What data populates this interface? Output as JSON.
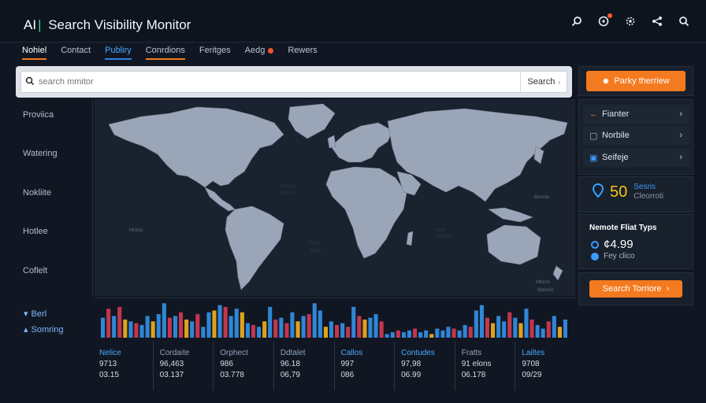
{
  "app": {
    "title_prefix": "AI",
    "title": "Search Visibility Monitor"
  },
  "top_icons": [
    "search-icon",
    "alert-icon",
    "settings-icon",
    "share-icon",
    "search-icon"
  ],
  "tabs": [
    {
      "label": "Nohiel"
    },
    {
      "label": "Contact"
    },
    {
      "label": "Publiry"
    },
    {
      "label": "Conrdions"
    },
    {
      "label": "Feritges"
    },
    {
      "label": "Aedg"
    },
    {
      "label": "Rewers"
    }
  ],
  "search": {
    "placeholder": "search mmitor",
    "button_label": "Search"
  },
  "leftnav": {
    "items": [
      "Proviica",
      "Watering",
      "Nokliite",
      "Hotlee",
      "Coflelt"
    ]
  },
  "map_labels": [
    "Desnia",
    "Cadsos",
    "Mroiss",
    "Nenit",
    "Reep",
    "Nolat",
    "Edmore",
    "Bosnia",
    "Mhens",
    "Moinsin"
  ],
  "legend": {
    "item1": "Berl",
    "item2": "Somring"
  },
  "table": {
    "columns": [
      {
        "header": "Nelice",
        "v1": "9713",
        "v2": "03.15"
      },
      {
        "header": "Cordaite",
        "v1": "96,463",
        "v2": "03.137"
      },
      {
        "header": "Orphect",
        "v1": "986",
        "v2": "03.778"
      },
      {
        "header": "Ddtalet",
        "v1": "96.18",
        "v2": "06,79"
      },
      {
        "header": "Callos",
        "v1": "997",
        "v2": "086"
      },
      {
        "header": "Contudes",
        "v1": "97,98",
        "v2": "06.99"
      },
      {
        "header": "Fratts",
        "v1": "91 elons",
        "v2": "06.178"
      },
      {
        "header": "Lailtes",
        "v1": "9708",
        "v2": "09/29"
      }
    ]
  },
  "right": {
    "primary_button": "Parky therriew",
    "items": [
      "Fianter",
      "Norbile",
      "Seifeje"
    ],
    "stat": {
      "value": "50",
      "label_a": "Sesris",
      "label_b": "Cleorroti"
    },
    "section_title": "Nemote Fliat Typs",
    "price": "¢4.99",
    "price_sub": "Fey clico",
    "secondary_button": "Search Torriore"
  },
  "colors": {
    "accent": "#f47a1f",
    "blue": "#3d9bff",
    "yellow": "#f5c518",
    "bg": "#111722"
  },
  "bar_data": [
    {
      "c": "b",
      "v": 0.55
    },
    {
      "c": "r",
      "v": 0.8
    },
    {
      "c": "b",
      "v": 0.6
    },
    {
      "c": "r",
      "v": 0.85
    },
    {
      "c": "y",
      "v": 0.5
    },
    {
      "c": "b",
      "v": 0.45
    },
    {
      "c": "r",
      "v": 0.4
    },
    {
      "c": "b",
      "v": 0.35
    },
    {
      "c": "b",
      "v": 0.6
    },
    {
      "c": "y",
      "v": 0.45
    },
    {
      "c": "b",
      "v": 0.65
    },
    {
      "c": "b",
      "v": 0.95
    },
    {
      "c": "r",
      "v": 0.55
    },
    {
      "c": "b",
      "v": 0.6
    },
    {
      "c": "r",
      "v": 0.7
    },
    {
      "c": "y",
      "v": 0.5
    },
    {
      "c": "b",
      "v": 0.45
    },
    {
      "c": "r",
      "v": 0.65
    },
    {
      "c": "b",
      "v": 0.3
    },
    {
      "c": "b",
      "v": 0.7
    },
    {
      "c": "y",
      "v": 0.75
    },
    {
      "c": "b",
      "v": 0.9
    },
    {
      "c": "r",
      "v": 0.85
    },
    {
      "c": "b",
      "v": 0.6
    },
    {
      "c": "b",
      "v": 0.8
    },
    {
      "c": "y",
      "v": 0.7
    },
    {
      "c": "b",
      "v": 0.4
    },
    {
      "c": "r",
      "v": 0.35
    },
    {
      "c": "b",
      "v": 0.3
    },
    {
      "c": "y",
      "v": 0.45
    },
    {
      "c": "b",
      "v": 0.85
    },
    {
      "c": "r",
      "v": 0.5
    },
    {
      "c": "b",
      "v": 0.55
    },
    {
      "c": "r",
      "v": 0.4
    },
    {
      "c": "b",
      "v": 0.7
    },
    {
      "c": "y",
      "v": 0.45
    },
    {
      "c": "b",
      "v": 0.6
    },
    {
      "c": "r",
      "v": 0.65
    },
    {
      "c": "b",
      "v": 0.95
    },
    {
      "c": "b",
      "v": 0.75
    },
    {
      "c": "y",
      "v": 0.3
    },
    {
      "c": "b",
      "v": 0.45
    },
    {
      "c": "r",
      "v": 0.35
    },
    {
      "c": "b",
      "v": 0.4
    },
    {
      "c": "r",
      "v": 0.3
    },
    {
      "c": "b",
      "v": 0.85
    },
    {
      "c": "r",
      "v": 0.6
    },
    {
      "c": "y",
      "v": 0.5
    },
    {
      "c": "b",
      "v": 0.55
    },
    {
      "c": "b",
      "v": 0.65
    },
    {
      "c": "r",
      "v": 0.45
    },
    {
      "c": "b",
      "v": 0.1
    },
    {
      "c": "b",
      "v": 0.15
    },
    {
      "c": "r",
      "v": 0.2
    },
    {
      "c": "b",
      "v": 0.15
    },
    {
      "c": "b",
      "v": 0.2
    },
    {
      "c": "r",
      "v": 0.25
    },
    {
      "c": "b",
      "v": 0.15
    },
    {
      "c": "b",
      "v": 0.2
    },
    {
      "c": "y",
      "v": 0.1
    },
    {
      "c": "b",
      "v": 0.25
    },
    {
      "c": "b",
      "v": 0.2
    },
    {
      "c": "b",
      "v": 0.3
    },
    {
      "c": "r",
      "v": 0.25
    },
    {
      "c": "b",
      "v": 0.2
    },
    {
      "c": "b",
      "v": 0.35
    },
    {
      "c": "r",
      "v": 0.3
    },
    {
      "c": "b",
      "v": 0.75
    },
    {
      "c": "b",
      "v": 0.9
    },
    {
      "c": "r",
      "v": 0.55
    },
    {
      "c": "y",
      "v": 0.4
    },
    {
      "c": "b",
      "v": 0.6
    },
    {
      "c": "b",
      "v": 0.45
    },
    {
      "c": "r",
      "v": 0.7
    },
    {
      "c": "b",
      "v": 0.55
    },
    {
      "c": "y",
      "v": 0.4
    },
    {
      "c": "b",
      "v": 0.8
    },
    {
      "c": "r",
      "v": 0.5
    },
    {
      "c": "b",
      "v": 0.35
    },
    {
      "c": "b",
      "v": 0.25
    },
    {
      "c": "r",
      "v": 0.45
    },
    {
      "c": "b",
      "v": 0.6
    },
    {
      "c": "y",
      "v": 0.3
    },
    {
      "c": "b",
      "v": 0.5
    }
  ]
}
